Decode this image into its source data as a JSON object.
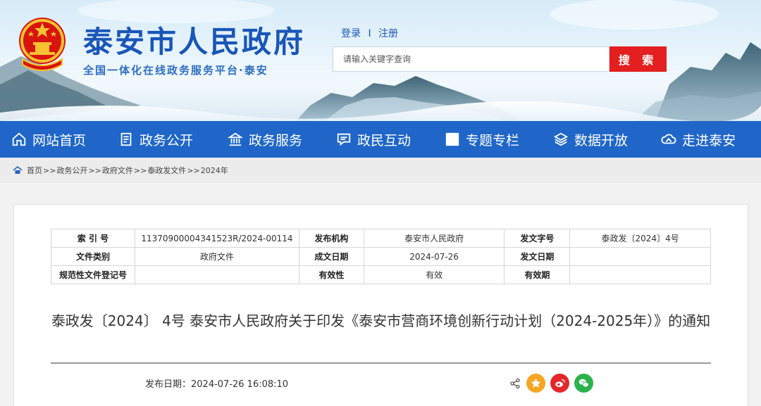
{
  "header": {
    "site_title": "泰安市人民政府",
    "site_subtitle": "全国一体化在线政务服务平台·泰安",
    "login_label": "登录",
    "register_label": "注册",
    "search_placeholder": "请输入关键字查询",
    "search_button": "搜 索"
  },
  "nav": {
    "items": [
      {
        "label": "网站首页",
        "icon": "home-icon"
      },
      {
        "label": "政务公开",
        "icon": "document-icon"
      },
      {
        "label": "政务服务",
        "icon": "building-icon"
      },
      {
        "label": "政民互动",
        "icon": "chat-icon"
      },
      {
        "label": "专题专栏",
        "icon": "grid-icon"
      },
      {
        "label": "数据开放",
        "icon": "layers-icon"
      },
      {
        "label": "走进泰安",
        "icon": "cloud-mountain-icon"
      }
    ]
  },
  "breadcrumb": {
    "items": [
      "首页",
      "政务公开",
      "政府文件",
      "泰政发文件",
      "2024年"
    ],
    "separator": ">>"
  },
  "meta": {
    "index_label": "索 引 号",
    "index_value": "11370900004341523R/2024-00114",
    "issuer_label": "发布机构",
    "issuer_value": "泰安市人民政府",
    "doc_no_label": "发文字号",
    "doc_no_value": "泰政发〔2024〕4号",
    "category_label": "文件类别",
    "category_value": "政府文件",
    "created_label": "成文日期",
    "created_value": "2024-07-26",
    "issued_label": "发文日期",
    "issued_value": "",
    "reg_label": "规范性文件登记号",
    "reg_value": "",
    "validity_label": "有效性",
    "validity_value": "有效",
    "valid_until_label": "有效期",
    "valid_until_value": ""
  },
  "document": {
    "title": "泰政发〔2024〕 4号 泰安市人民政府关于印发《泰安市营商环境创新行动计划（2024-2025年）》的通知",
    "publish_date": "发布日期：2024-07-26 16:08:10"
  },
  "colors": {
    "brand_blue": "#1f66c8",
    "search_red": "#e41f1f",
    "favorite_orange": "#f5a623",
    "weibo_red": "#e5262b",
    "wechat_green": "#2bb24c"
  }
}
